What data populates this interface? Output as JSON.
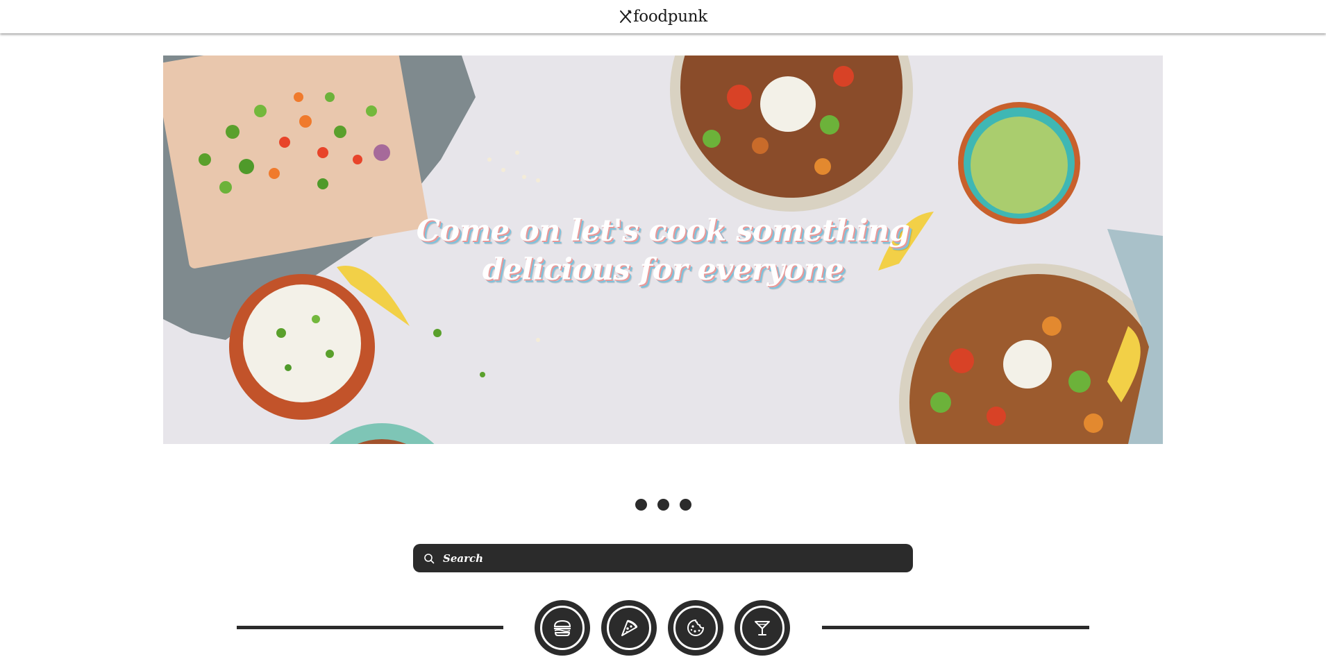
{
  "header": {
    "logo_text": "foodpunk",
    "logo_icon": "fork-knife-icon"
  },
  "hero": {
    "caption_line1": "Come on let's cook something",
    "caption_line2": "delicious for everyone"
  },
  "carousel": {
    "dot_count": 3
  },
  "search": {
    "placeholder": "Search",
    "icon": "search-icon"
  },
  "categories": [
    {
      "name": "burger",
      "icon": "burger-icon"
    },
    {
      "name": "pizza",
      "icon": "pizza-icon"
    },
    {
      "name": "cookie",
      "icon": "cookie-icon"
    },
    {
      "name": "cocktail",
      "icon": "cocktail-icon"
    }
  ],
  "colors": {
    "dark": "#2b2b2b",
    "caption_shadow_pink": "#e79a9a",
    "caption_shadow_blue": "#7ec2dc",
    "hero_background": "#e7e5ea"
  }
}
